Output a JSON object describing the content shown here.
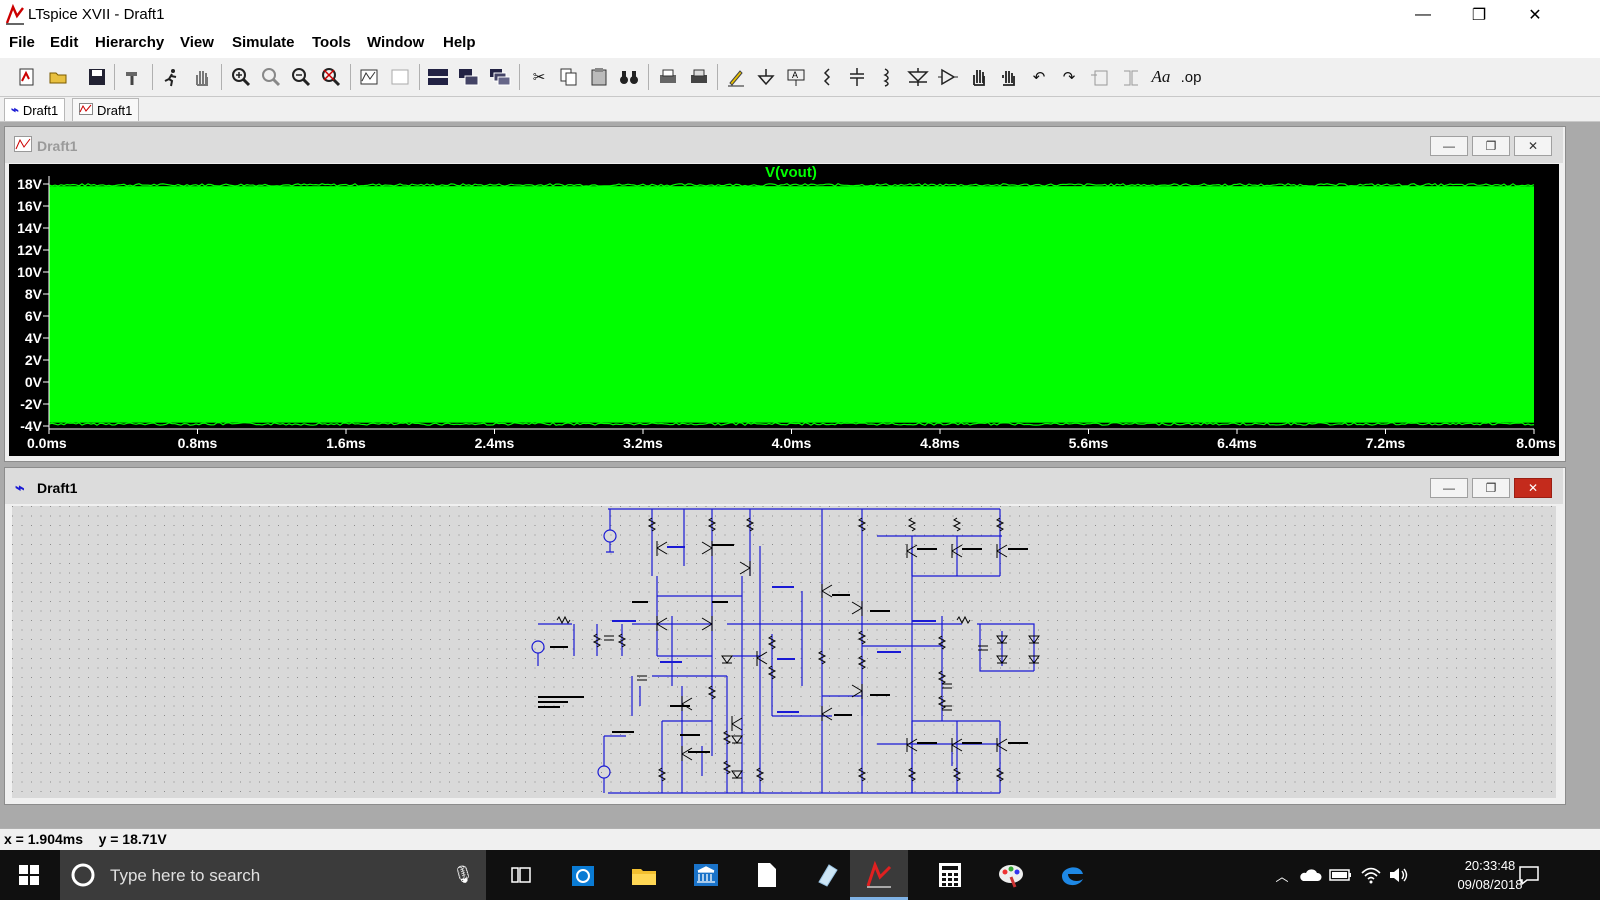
{
  "window": {
    "title": "LTspice XVII - Draft1",
    "minimize": "—",
    "restore": "❐",
    "close": "✕"
  },
  "menu": [
    {
      "label": "File"
    },
    {
      "label": "Edit"
    },
    {
      "label": "Hierarchy"
    },
    {
      "label": "View"
    },
    {
      "label": "Simulate"
    },
    {
      "label": "Tools"
    },
    {
      "label": "Window"
    },
    {
      "label": "Help"
    }
  ],
  "toolbar": {
    "text_tool": "Aa",
    "spice_tool": ".op"
  },
  "tabs": [
    {
      "label": "Draft1"
    },
    {
      "label": "Draft1"
    }
  ],
  "waveform": {
    "title": "Draft1",
    "trace": "V(vout)",
    "trace_color": "#00ff00",
    "yticks": [
      "18V",
      "16V",
      "14V",
      "12V",
      "10V",
      "8V",
      "6V",
      "4V",
      "2V",
      "0V",
      "-2V",
      "-4V"
    ],
    "xticks": [
      "0.0ms",
      "0.8ms",
      "1.6ms",
      "2.4ms",
      "3.2ms",
      "4.0ms",
      "4.8ms",
      "5.6ms",
      "6.4ms",
      "7.2ms",
      "8.0ms"
    ]
  },
  "chart_data": {
    "type": "area",
    "series": [
      {
        "name": "V(vout)",
        "min": -3.7,
        "max": 17.8
      }
    ],
    "x_start": 0.0,
    "x_end": 8.0,
    "xlabel": "",
    "ylabel": "",
    "xlim": [
      0.0,
      8.0
    ],
    "ylim": [
      -4,
      18
    ],
    "grid": false
  },
  "schematic": {
    "title": "Draft1"
  },
  "status": {
    "readout": "x = 1.904ms    y = 18.71V"
  },
  "taskbar": {
    "search_placeholder": "Type here to search",
    "time": "20:33:48",
    "date": "09/08/2018"
  },
  "colors": {
    "wire": "#1a1ad4",
    "plot_bg": "#000000",
    "close_red": "#c42b1c"
  }
}
